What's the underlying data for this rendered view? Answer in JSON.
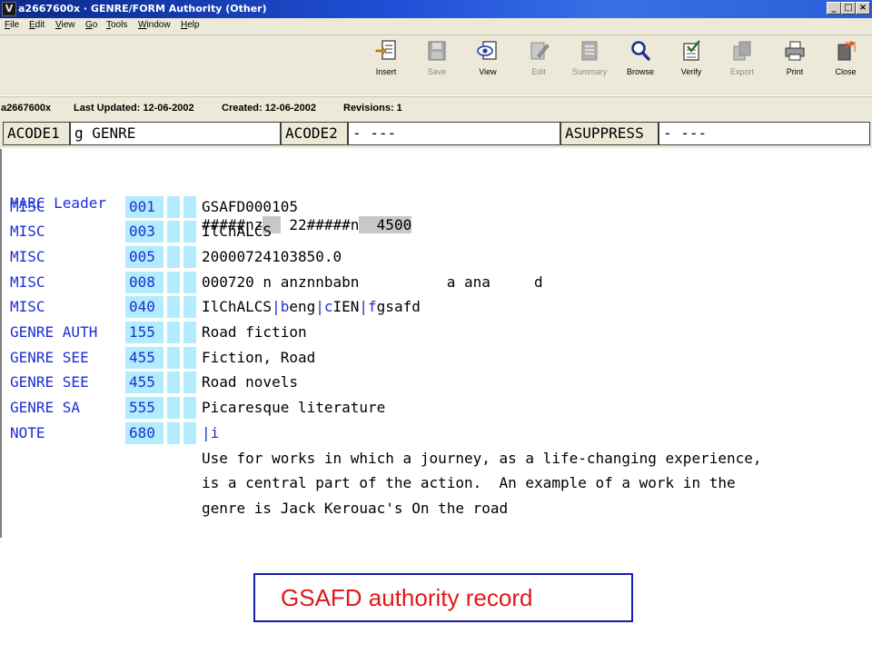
{
  "window": {
    "title": "a2667600x · GENRE/FORM Authority (Other)",
    "controls": {
      "minimize": "_",
      "restore": "□",
      "close": "×"
    }
  },
  "menu": [
    "File",
    "Edit",
    "View",
    "Go",
    "Tools",
    "Window",
    "Help"
  ],
  "toolbar": [
    {
      "label": "Insert",
      "icon": "insert-icon",
      "enabled": true
    },
    {
      "label": "Save",
      "icon": "save-icon",
      "enabled": false
    },
    {
      "label": "View",
      "icon": "view-icon",
      "enabled": true
    },
    {
      "label": "Edit",
      "icon": "edit-icon",
      "enabled": false
    },
    {
      "label": "Summary",
      "icon": "summary-icon",
      "enabled": false
    },
    {
      "label": "Browse",
      "icon": "browse-icon",
      "enabled": true
    },
    {
      "label": "Verify",
      "icon": "verify-icon",
      "enabled": true
    },
    {
      "label": "Export",
      "icon": "export-icon",
      "enabled": false
    },
    {
      "label": "Print",
      "icon": "print-icon",
      "enabled": true
    },
    {
      "label": "Close",
      "icon": "close-icon",
      "enabled": true
    }
  ],
  "info": {
    "record_id": "a2667600x",
    "last_updated": "Last Updated: 12-06-2002",
    "created": "Created: 12-06-2002",
    "revisions": "Revisions: 1"
  },
  "fixed_fields": [
    {
      "label": "ACODE1",
      "value": "g GENRE"
    },
    {
      "label": "ACODE2",
      "value": "- ---"
    },
    {
      "label": "ASUPPRESS",
      "value": "- ---"
    }
  ],
  "leader": {
    "label": "MARC Leader",
    "parts": [
      "#####nz",
      "  ",
      " ",
      "22#####n",
      "  ",
      "4500"
    ]
  },
  "fields": [
    {
      "label": "MISC",
      "tag": "001",
      "data": [
        [
          "GSAFD000105",
          false
        ]
      ]
    },
    {
      "label": "MISC",
      "tag": "003",
      "data": [
        [
          "IlChALCS",
          false
        ]
      ]
    },
    {
      "label": "MISC",
      "tag": "005",
      "data": [
        [
          "20000724103850.0",
          false
        ]
      ]
    },
    {
      "label": "MISC",
      "tag": "008",
      "data": [
        [
          "000720 n anznnbabn          a ana     d",
          false
        ]
      ]
    },
    {
      "label": "MISC",
      "tag": "040",
      "data": [
        [
          "IlChALCS",
          false
        ],
        [
          "|b",
          true
        ],
        [
          "eng",
          false
        ],
        [
          "|c",
          true
        ],
        [
          "IEN",
          false
        ],
        [
          "|f",
          true
        ],
        [
          "gsafd",
          false
        ]
      ]
    },
    {
      "label": "GENRE AUTH",
      "tag": "155",
      "data": [
        [
          "Road fiction",
          false
        ]
      ]
    },
    {
      "label": "GENRE SEE",
      "tag": "455",
      "data": [
        [
          "Fiction, Road",
          false
        ]
      ]
    },
    {
      "label": "GENRE SEE",
      "tag": "455",
      "data": [
        [
          "Road novels",
          false
        ]
      ]
    },
    {
      "label": "GENRE SA",
      "tag": "555",
      "data": [
        [
          "Picaresque literature",
          false
        ]
      ]
    },
    {
      "label": "NOTE",
      "tag": "680",
      "data": [
        [
          "|i",
          true
        ]
      ]
    }
  ],
  "note_lines": [
    "Use for works in which a journey, as a life-changing experience,",
    "is a central part of the action.  An example of a work in the",
    "genre is Jack Kerouac's On the road"
  ],
  "caption": "GSAFD authority record",
  "colors": {
    "label_blue": "#1b2fd6",
    "tag_highlight": "#b3ecfc",
    "caption_text": "#e01818",
    "caption_border": "#1b1bb0",
    "chrome": "#ece9d8"
  }
}
